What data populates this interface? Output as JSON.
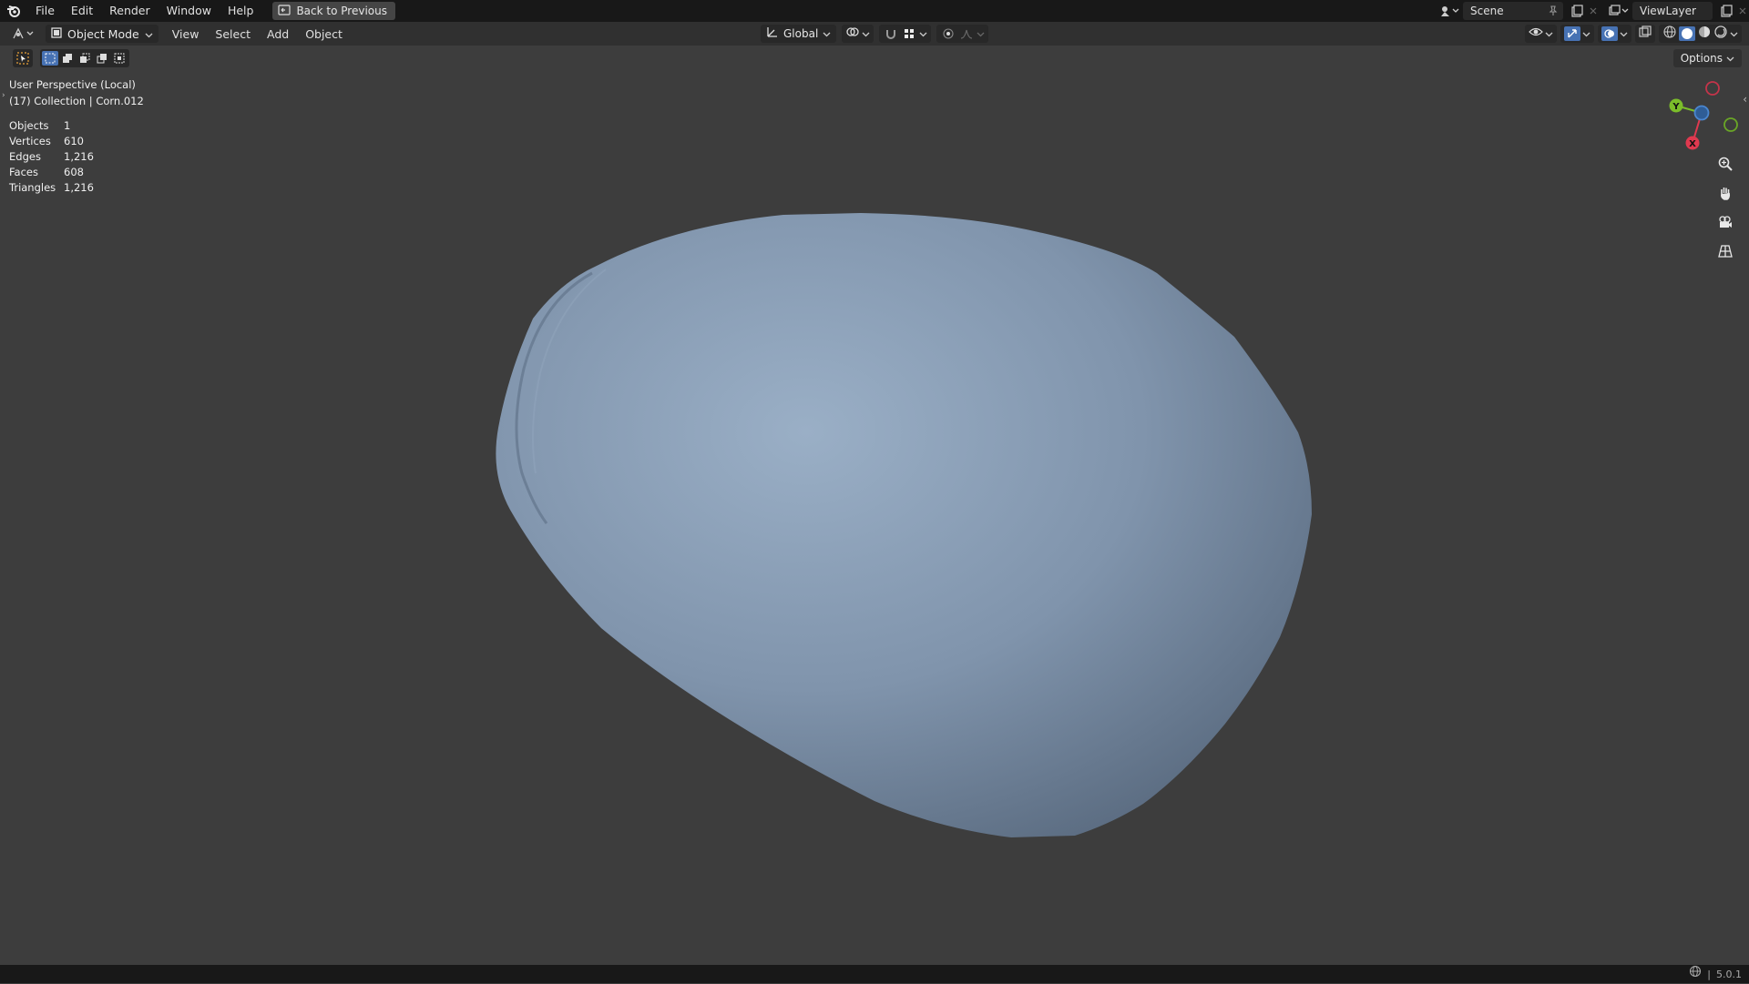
{
  "menubar": {
    "items": [
      "File",
      "Edit",
      "Render",
      "Window",
      "Help"
    ],
    "back_button": "Back to Previous"
  },
  "scene": {
    "name": "Scene"
  },
  "view_layer": {
    "name": "ViewLayer"
  },
  "header": {
    "mode": "Object Mode",
    "menus": [
      "View",
      "Select",
      "Add",
      "Object"
    ],
    "transform_orientation": "Global"
  },
  "toolbar": {
    "options_label": "Options"
  },
  "viewport": {
    "perspective": "User Perspective (Local)",
    "collection_info": "(17) Collection | Corn.012",
    "stats": [
      {
        "label": "Objects",
        "value": "1"
      },
      {
        "label": "Vertices",
        "value": "610"
      },
      {
        "label": "Edges",
        "value": "1,216"
      },
      {
        "label": "Faces",
        "value": "608"
      },
      {
        "label": "Triangles",
        "value": "1,216"
      }
    ],
    "mesh_color": "#7f93aa",
    "background_color": "#3d3d3d"
  },
  "gizmo": {
    "x_label": "X",
    "y_label": "Y",
    "x_color": "#e0394f",
    "y_color": "#7bbd2a",
    "z_color": "#3a80d6"
  },
  "status": {
    "version": "5.0.1"
  }
}
